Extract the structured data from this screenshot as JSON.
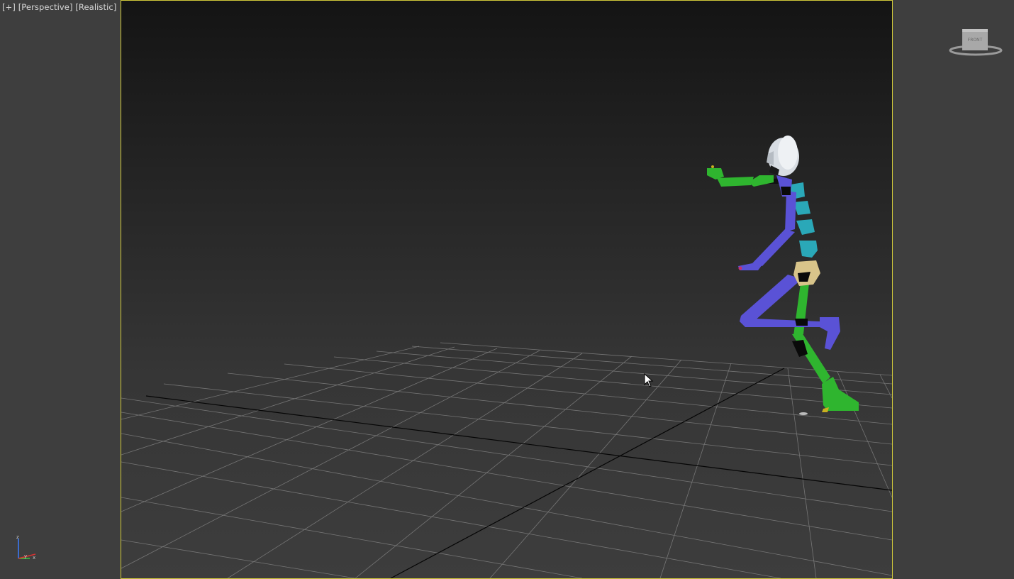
{
  "viewport": {
    "label": {
      "plus": "[+]",
      "view": "[Perspective]",
      "shading": "[Realistic]"
    },
    "active_border_color": "#d1c93a"
  },
  "axis_tripod": {
    "z": "z",
    "y": "y",
    "x": "x"
  },
  "viewcube": {
    "face_label": "FRONT",
    "icon": "viewcube-icon"
  },
  "colors": {
    "limb_blue": "#5a52d6",
    "limb_green": "#2fb52f",
    "spine_cyan": "#2aa8b8",
    "pelvis_tan": "#d8c48a",
    "head_white": "#d8dde3"
  }
}
